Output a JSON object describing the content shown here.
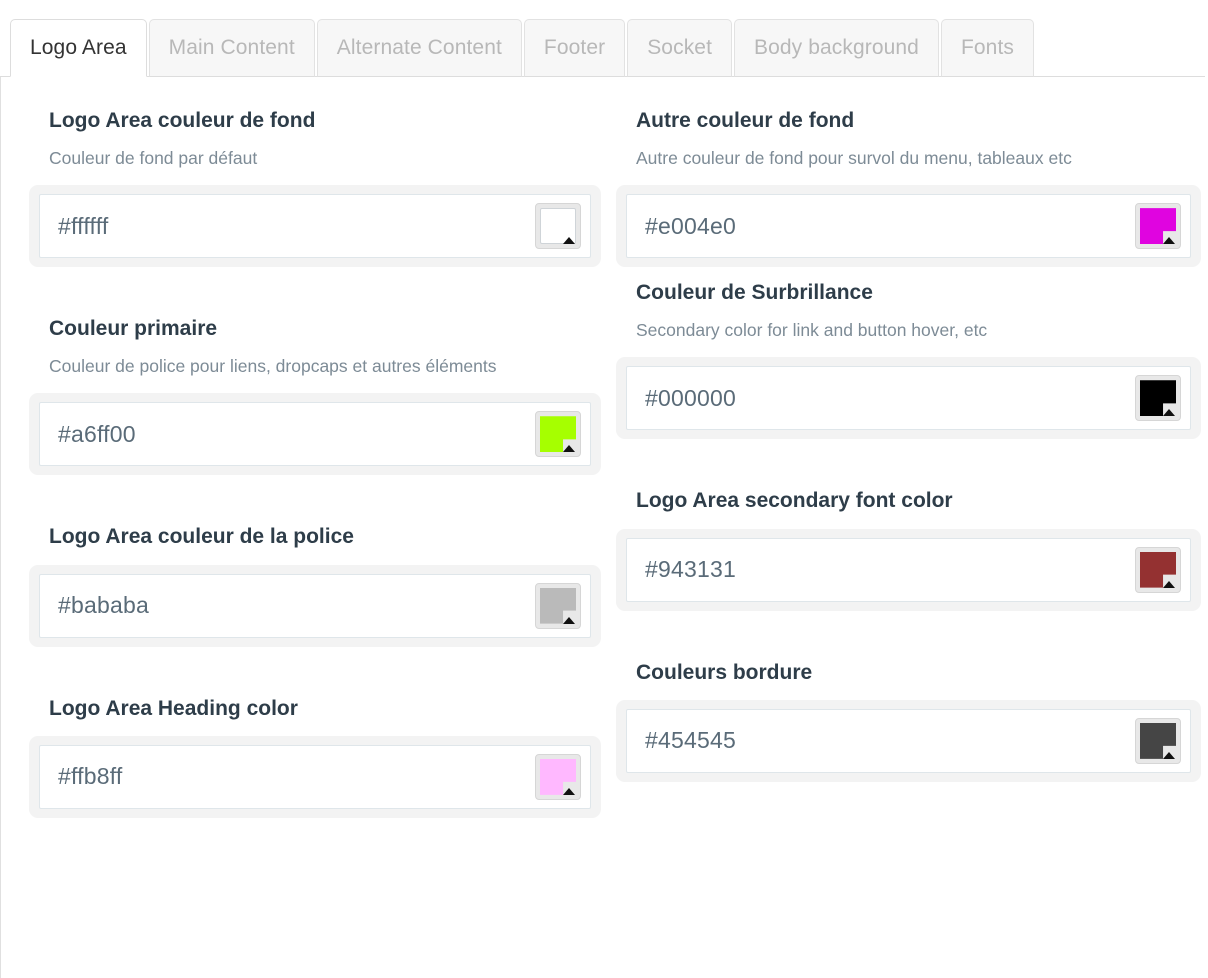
{
  "tabs": [
    {
      "label": "Logo Area",
      "active": true
    },
    {
      "label": "Main Content",
      "active": false
    },
    {
      "label": "Alternate Content",
      "active": false
    },
    {
      "label": "Footer",
      "active": false
    },
    {
      "label": "Socket",
      "active": false
    },
    {
      "label": "Body background",
      "active": false
    },
    {
      "label": "Fonts",
      "active": false
    }
  ],
  "left_fields": [
    {
      "title": "Logo Area couleur de fond",
      "description": "Couleur de fond par défaut",
      "value": "#ffffff",
      "swatch_color": "#ffffff",
      "swatch_notch": false,
      "top_margin": 30,
      "bottom_margin": 48
    },
    {
      "title": "Couleur primaire",
      "description": "Couleur de police pour liens, dropcaps et autres éléments",
      "value": "#a6ff00",
      "swatch_color": "#a6ff00",
      "swatch_notch": true,
      "top_margin": 0,
      "bottom_margin": 48
    },
    {
      "title": "Logo Area couleur de la police",
      "description": "",
      "value": "#bababa",
      "swatch_color": "#bababa",
      "swatch_notch": true,
      "top_margin": 0,
      "bottom_margin": 48
    },
    {
      "title": "Logo Area Heading color",
      "description": "",
      "value": "#ffb8ff",
      "swatch_color": "#ffb8ff",
      "swatch_notch": true,
      "top_margin": 0,
      "bottom_margin": 0
    }
  ],
  "right_fields": [
    {
      "title": "Autre couleur de fond",
      "description": "Autre couleur de fond pour survol du menu, tableaux etc",
      "value": "#e004e0",
      "swatch_color": "#e004e0",
      "swatch_notch": true,
      "top_margin": 30,
      "bottom_margin": 12
    },
    {
      "title": "Couleur de Surbrillance",
      "description": "Secondary color for link and button hover, etc",
      "value": "#000000",
      "swatch_color": "#000000",
      "swatch_notch": true,
      "top_margin": 0,
      "bottom_margin": 48
    },
    {
      "title": "Logo Area secondary font color",
      "description": "",
      "value": "#943131",
      "swatch_color": "#943131",
      "swatch_notch": true,
      "top_margin": 0,
      "bottom_margin": 48
    },
    {
      "title": "Couleurs bordure",
      "description": "",
      "value": "#454545",
      "swatch_color": "#454545",
      "swatch_notch": true,
      "top_margin": 0,
      "bottom_margin": 0
    }
  ],
  "colors": {
    "heading_text": "#2e3d49",
    "description_text": "#7d8b96",
    "input_text": "#5a6b78",
    "tab_active_text": "#333333",
    "tab_inactive_text": "#b8b8b8",
    "panel_background": "#ffffff",
    "field_container": "#f3f3f3"
  }
}
